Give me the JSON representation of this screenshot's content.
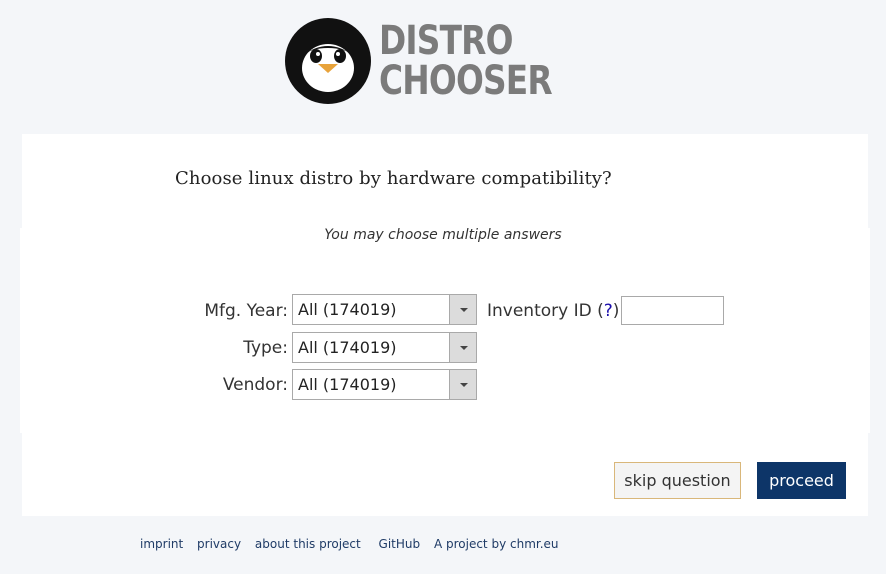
{
  "header": {
    "logo_line1": "DISTRO",
    "logo_line2": "CHOOSER"
  },
  "question": {
    "title": "Choose linux distro by hardware compatibility?",
    "hint": "You may choose multiple answers"
  },
  "filters": {
    "mfg_year": {
      "label": "Mfg. Year:",
      "value": "All (174019)"
    },
    "type": {
      "label": "Type:",
      "value": "All (174019)"
    },
    "vendor": {
      "label": "Vendor:",
      "value": "All (174019)"
    },
    "inventory": {
      "label": "Inventory ID (",
      "help": "?",
      "suffix": "):",
      "value": ""
    }
  },
  "actions": {
    "skip_label": "skip question",
    "proceed_label": "proceed"
  },
  "footer": {
    "links": [
      "imprint",
      "privacy",
      "about this project",
      "GitHub",
      "A project by chmr.eu"
    ]
  },
  "colors": {
    "proceed_bg": "#0d3568",
    "skip_border": "#d9b77a",
    "page_bg": "#f4f6f9",
    "logo_text": "#7b7b7b"
  },
  "icons": {
    "logo": "penguin-logo-icon",
    "dropdown": "chevron-down-icon"
  }
}
